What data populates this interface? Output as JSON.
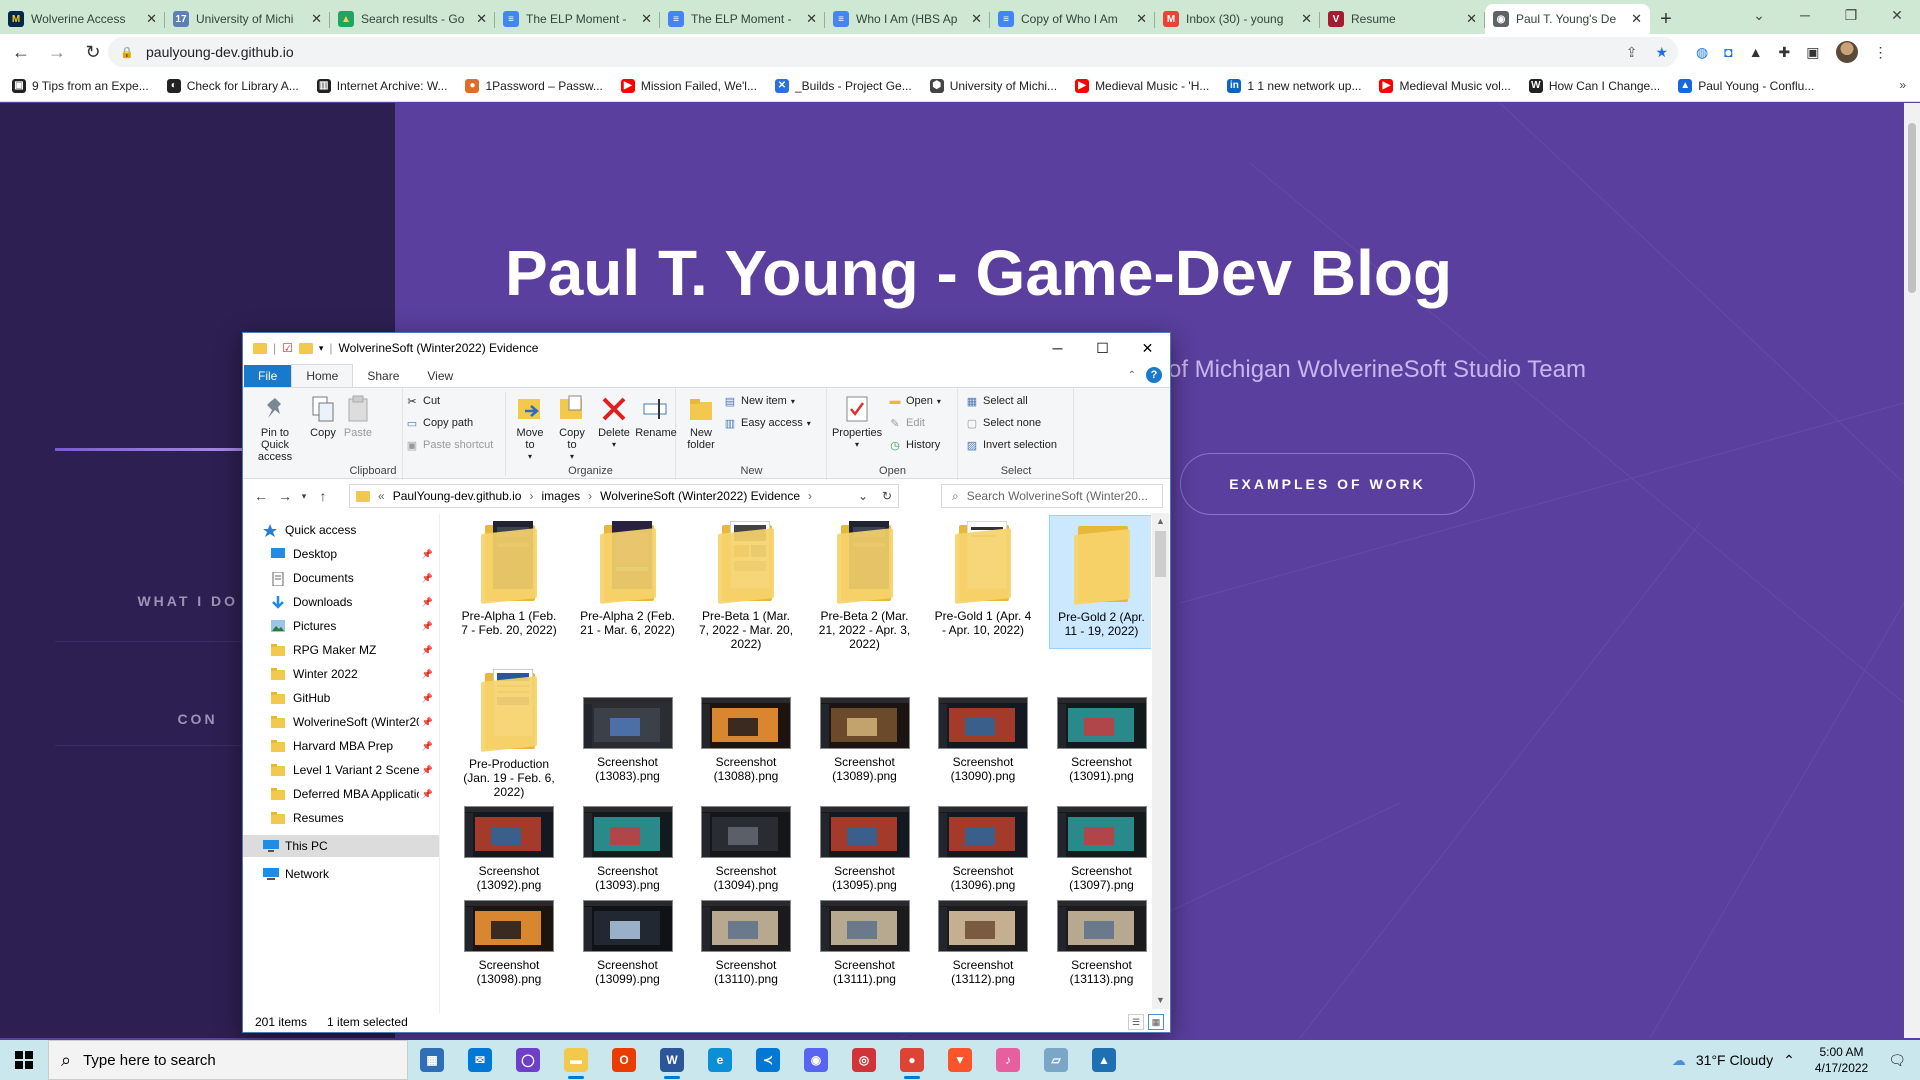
{
  "browser": {
    "tabs": [
      {
        "label": "Wolverine Access",
        "fav_color": "#00274c",
        "fav_text": "M",
        "fav_fg": "#ffcb05"
      },
      {
        "label": "University of Michi",
        "fav_color": "#5d7fb8",
        "fav_text": "17",
        "fav_fg": "#ffffff"
      },
      {
        "label": "Search results - Go",
        "fav_color": "#1fa463",
        "fav_text": "▲",
        "fav_fg": "#ffd04b"
      },
      {
        "label": "The ELP Moment -",
        "fav_color": "#4285f4",
        "fav_text": "≡",
        "fav_fg": "#ffffff"
      },
      {
        "label": "The ELP Moment -",
        "fav_color": "#4285f4",
        "fav_text": "≡",
        "fav_fg": "#ffffff"
      },
      {
        "label": "Who I Am (HBS Ap",
        "fav_color": "#4285f4",
        "fav_text": "≡",
        "fav_fg": "#ffffff"
      },
      {
        "label": "Copy of Who I Am",
        "fav_color": "#4285f4",
        "fav_text": "≡",
        "fav_fg": "#ffffff"
      },
      {
        "label": "Inbox (30) - young",
        "fav_color": "#ea4335",
        "fav_text": "M",
        "fav_fg": "#ffffff"
      },
      {
        "label": "Resume",
        "fav_color": "#a51c30",
        "fav_text": "V",
        "fav_fg": "#ffffff"
      },
      {
        "label": "Paul T. Young's De",
        "fav_color": "#5f6368",
        "fav_text": "◉",
        "fav_fg": "#ffffff",
        "active": true
      }
    ],
    "new_tab": "+",
    "url": "paulyoung-dev.github.io"
  },
  "bookmarks": [
    {
      "label": "9 Tips from an Expe...",
      "color": "#222222",
      "icon": "▣"
    },
    {
      "label": "Check for Library A...",
      "color": "#222222",
      "icon": "◐"
    },
    {
      "label": "Internet Archive: W...",
      "color": "#222222",
      "icon": "▥"
    },
    {
      "label": "1Password – Passw...",
      "color": "#e06c2b",
      "icon": "●"
    },
    {
      "label": "Mission Failed, We'l...",
      "color": "#ff0000",
      "icon": "▶"
    },
    {
      "label": "_Builds - Project Ge...",
      "color": "#2b6fe0",
      "icon": "✕"
    },
    {
      "label": "University of Michi...",
      "color": "#444444",
      "icon": "⬢"
    },
    {
      "label": "Medieval Music - 'H...",
      "color": "#ff0000",
      "icon": "▶"
    },
    {
      "label": "1 1 new network up...",
      "color": "#0a66c2",
      "icon": "in"
    },
    {
      "label": "Medieval Music vol...",
      "color": "#ff0000",
      "icon": "▶"
    },
    {
      "label": "How Can I Change...",
      "color": "#222222",
      "icon": "W"
    },
    {
      "label": "Paul Young - Conflu...",
      "color": "#1868db",
      "icon": "▲"
    }
  ],
  "bookmarks_more": "»",
  "webpage": {
    "title": "Paul T. Young - Game-Dev Blog",
    "subtitle": "of Michigan WolverineSoft Studio Team",
    "examples_button": "EXAMPLES OF WORK",
    "side_nav_1": "WHAT I DO A",
    "side_nav_2": "CON"
  },
  "explorer": {
    "title": "WolverineSoft (Winter2022) Evidence",
    "ribbon_tabs": {
      "file": "File",
      "home": "Home",
      "share": "Share",
      "view": "View"
    },
    "ribbon": {
      "pin": "Pin to Quick access",
      "copy": "Copy",
      "paste": "Paste",
      "cut": "Cut",
      "copy_path": "Copy path",
      "paste_shortcut": "Paste shortcut",
      "clipboard": "Clipboard",
      "move_to": "Move to",
      "copy_to": "Copy to",
      "delete": "Delete",
      "rename": "Rename",
      "organize": "Organize",
      "new_folder": "New folder",
      "new_item": "New item",
      "easy_access": "Easy access",
      "new": "New",
      "properties": "Properties",
      "open": "Open",
      "edit": "Edit",
      "history": "History",
      "open_group": "Open",
      "select_all": "Select all",
      "select_none": "Select none",
      "invert_selection": "Invert selection",
      "select": "Select"
    },
    "address": {
      "prefix": "«",
      "crumbs": [
        "PaulYoung-dev.github.io",
        "images",
        "WolverineSoft (Winter2022) Evidence"
      ]
    },
    "search_placeholder": "Search WolverineSoft (Winter20...",
    "nav": [
      {
        "label": "Quick access",
        "icon": "star",
        "indent": 0,
        "pinned": false
      },
      {
        "label": "Desktop",
        "icon": "desktop",
        "indent": 1,
        "pinned": true
      },
      {
        "label": "Documents",
        "icon": "docs",
        "indent": 1,
        "pinned": true
      },
      {
        "label": "Downloads",
        "icon": "down",
        "indent": 1,
        "pinned": true
      },
      {
        "label": "Pictures",
        "icon": "pics",
        "indent": 1,
        "pinned": true
      },
      {
        "label": "RPG Maker MZ",
        "icon": "folder",
        "indent": 1,
        "pinned": true
      },
      {
        "label": "Winter 2022",
        "icon": "folder",
        "indent": 1,
        "pinned": true
      },
      {
        "label": "GitHub",
        "icon": "folder",
        "indent": 1,
        "pinned": true
      },
      {
        "label": "WolverineSoft (Winter20",
        "icon": "folder",
        "indent": 1,
        "pinned": true
      },
      {
        "label": "Harvard MBA Prep",
        "icon": "folder",
        "indent": 1,
        "pinned": true
      },
      {
        "label": "Level 1 Variant 2 Scene-",
        "icon": "folder",
        "indent": 1,
        "pinned": true
      },
      {
        "label": "Deferred MBA Applicatio",
        "icon": "folder",
        "indent": 1,
        "pinned": true
      },
      {
        "label": "Resumes",
        "icon": "folder",
        "indent": 1,
        "pinned": false
      },
      {
        "label": "This PC",
        "icon": "pc",
        "indent": 0,
        "pinned": false,
        "selected": true
      },
      {
        "label": "Network",
        "icon": "net",
        "indent": 0,
        "pinned": false
      }
    ],
    "folders": [
      {
        "label": "Pre-Alpha 1 (Feb. 7 - Feb. 20, 2022)",
        "theme": "dark"
      },
      {
        "label": "Pre-Alpha 2 (Feb. 21 - Mar. 6, 2022)",
        "theme": "purple"
      },
      {
        "label": "Pre-Beta 1 (Mar. 7, 2022 - Mar. 20, 2022)",
        "theme": "web"
      },
      {
        "label": "Pre-Beta 2 (Mar. 21, 2022 - Apr. 3, 2022)",
        "theme": "dark"
      },
      {
        "label": "Pre-Gold 1 (Apr. 4 - Apr. 10, 2022)",
        "theme": "white"
      },
      {
        "label": "Pre-Gold 2 (Apr. 11 - 19, 2022)",
        "theme": "empty",
        "selected": true
      },
      {
        "label": "Pre-Production (Jan. 19 - Feb. 6, 2022)",
        "theme": "doc"
      }
    ],
    "images": [
      {
        "label": "Screenshot (13083).png",
        "theme": "editor"
      },
      {
        "label": "Screenshot (13088).png",
        "theme": "sunset"
      },
      {
        "label": "Screenshot (13089).png",
        "theme": "brown"
      },
      {
        "label": "Screenshot (13090).png",
        "theme": "red"
      },
      {
        "label": "Screenshot (13091).png",
        "theme": "teal"
      },
      {
        "label": "Screenshot (13092).png",
        "theme": "red"
      },
      {
        "label": "Screenshot (13093).png",
        "theme": "teal"
      },
      {
        "label": "Screenshot (13094).png",
        "theme": "dark"
      },
      {
        "label": "Screenshot (13095).png",
        "theme": "red"
      },
      {
        "label": "Screenshot (13096).png",
        "theme": "red"
      },
      {
        "label": "Screenshot (13097).png",
        "theme": "teal"
      },
      {
        "label": "Screenshot (13098).png",
        "theme": "sunset"
      },
      {
        "label": "Screenshot (13099).png",
        "theme": "car"
      },
      {
        "label": "Screenshot (13110).png",
        "theme": "room"
      },
      {
        "label": "Screenshot (13111).png",
        "theme": "room"
      },
      {
        "label": "Screenshot (13112).png",
        "theme": "room2"
      },
      {
        "label": "Screenshot (13113).png",
        "theme": "room"
      }
    ],
    "status_count": "201 items",
    "status_selected": "1 item selected"
  },
  "taskbar": {
    "search_placeholder": "Type here to search",
    "apps": [
      {
        "name": "calculator",
        "color": "#2f6fb8",
        "glyph": "▦",
        "running": false
      },
      {
        "name": "mail",
        "color": "#0078d4",
        "glyph": "✉",
        "running": false
      },
      {
        "name": "github-desktop",
        "color": "#6e40c9",
        "glyph": "◯",
        "running": false
      },
      {
        "name": "file-explorer",
        "color": "#f2c94c",
        "glyph": "▬",
        "running": true
      },
      {
        "name": "office",
        "color": "#eb3c00",
        "glyph": "O",
        "running": false
      },
      {
        "name": "word",
        "color": "#2b579a",
        "glyph": "W",
        "running": true
      },
      {
        "name": "edge",
        "color": "#0c8fd6",
        "glyph": "e",
        "running": false
      },
      {
        "name": "vscode",
        "color": "#0078d4",
        "glyph": "≺",
        "running": false
      },
      {
        "name": "discord",
        "color": "#5865f2",
        "glyph": "◉",
        "running": false
      },
      {
        "name": "brave-red",
        "color": "#d13438",
        "glyph": "◎",
        "running": false
      },
      {
        "name": "chrome",
        "color": "#db4437",
        "glyph": "●",
        "running": true
      },
      {
        "name": "brave",
        "color": "#fb542b",
        "glyph": "▼",
        "running": false
      },
      {
        "name": "itunes",
        "color": "#e85fa0",
        "glyph": "♪",
        "running": false
      },
      {
        "name": "tool",
        "color": "#7aa7c7",
        "glyph": "▱",
        "running": false
      },
      {
        "name": "photos",
        "color": "#1f6fb2",
        "glyph": "▲",
        "running": false
      }
    ],
    "weather": "31°F  Cloudy",
    "time": "5:00 AM",
    "date": "4/17/2022"
  }
}
